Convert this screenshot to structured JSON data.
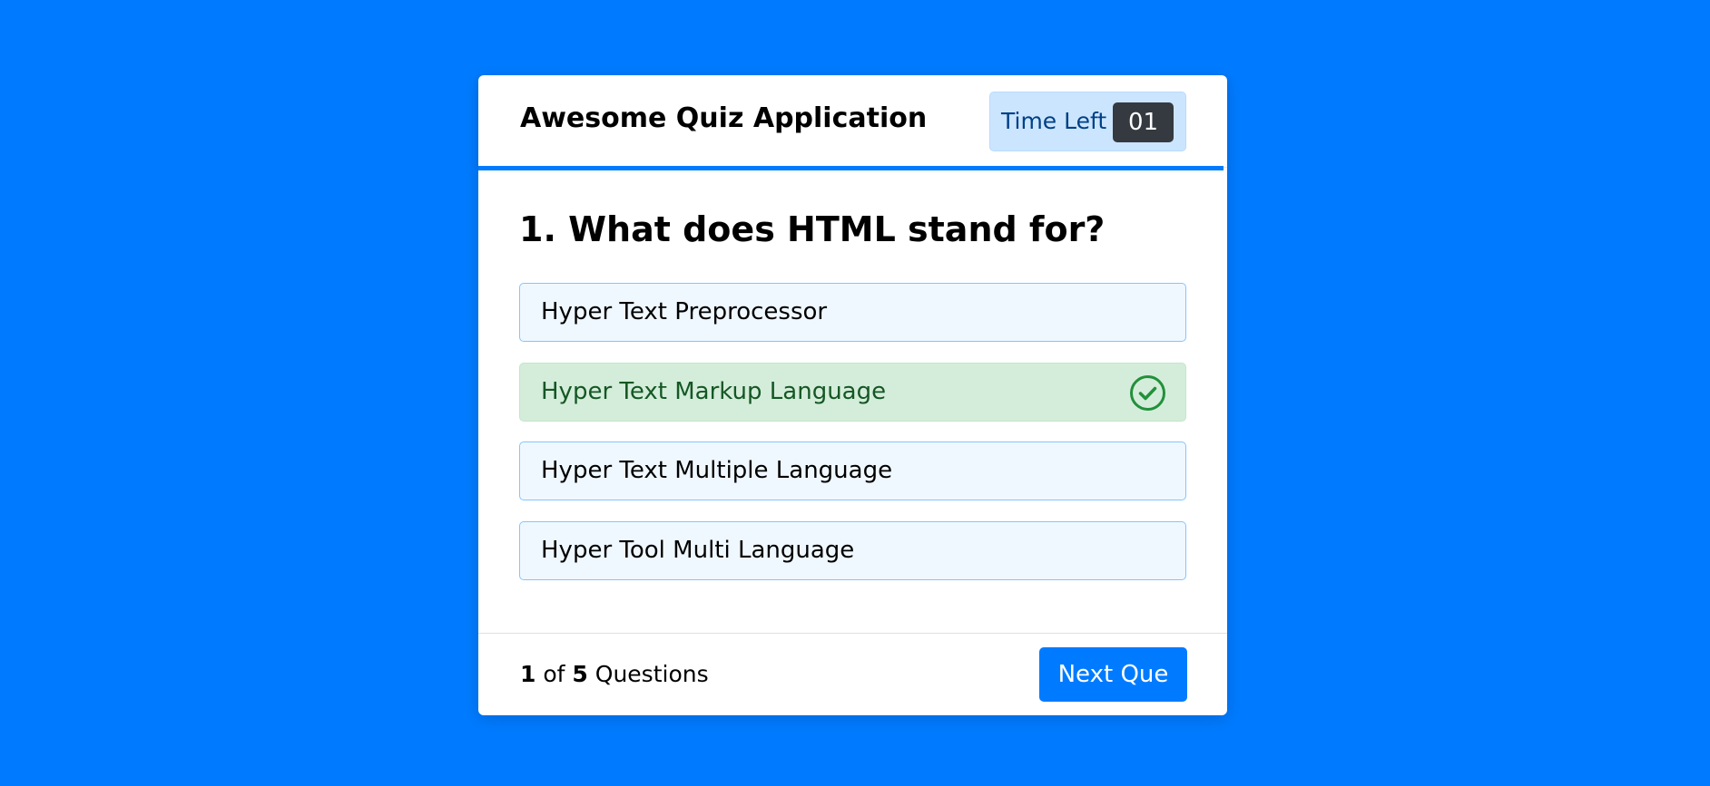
{
  "header": {
    "title": "Awesome Quiz Application",
    "timer_label": "Time Left",
    "timer_seconds": "01",
    "time_line_progress": 1.0
  },
  "question": {
    "text": "1. What does HTML stand for?",
    "options": [
      {
        "label": "Hyper Text Preprocessor",
        "state": "default"
      },
      {
        "label": "Hyper Text Markup Language",
        "state": "correct",
        "icon": "check-circle-icon"
      },
      {
        "label": "Hyper Text Multiple Language",
        "state": "default"
      },
      {
        "label": "Hyper Tool Multi Language",
        "state": "default"
      }
    ]
  },
  "footer": {
    "current": "1",
    "of_text": "of",
    "total": "5",
    "questions_text": "Questions",
    "next_label": "Next Que"
  },
  "colors": {
    "background": "#007bff",
    "accent": "#007bff",
    "correct_bg": "#d4edda",
    "correct_text": "#155724",
    "correct_icon": "#23903c",
    "option_bg": "#f0f8ff",
    "option_border": "#84c5fe",
    "timer_bg": "#cce5ff",
    "timer_sec_bg": "#343a40"
  }
}
